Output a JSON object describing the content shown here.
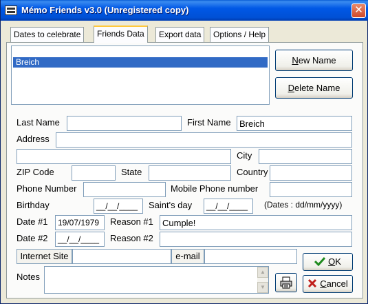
{
  "window": {
    "title": "Mémo Friends v3.0 (Unregistered copy)",
    "close": "✕"
  },
  "tabs": [
    {
      "label": "Dates to celebrate"
    },
    {
      "label": "Friends Data"
    },
    {
      "label": "Export data"
    },
    {
      "label": "Options / Help"
    }
  ],
  "friends_list": {
    "items": [
      "Breich"
    ],
    "selected": "Breich"
  },
  "buttons": {
    "new_name_u": "N",
    "new_name_rest": "ew Name",
    "delete_name_u": "D",
    "delete_name_rest": "elete Name",
    "ok_u": "O",
    "ok_rest": "K",
    "cancel_u": "C",
    "cancel_rest": "ancel",
    "internet_site": "Internet Site",
    "email": "e-mail"
  },
  "labels": {
    "last_name": "Last Name",
    "first_name": "First Name",
    "address": "Address",
    "city": "City",
    "zip": "ZIP Code",
    "state": "State",
    "country": "Country",
    "phone": "Phone Number",
    "mobile": "Mobile Phone number",
    "birthday": "Birthday",
    "saints_day": "Saint's day",
    "date_format": "(Dates : dd/mm/yyyy)",
    "date1": "Date #1",
    "reason1": "Reason #1",
    "date2": "Date #2",
    "reason2": "Reason #2",
    "notes": "Notes"
  },
  "values": {
    "last_name": "",
    "first_name": "Breich",
    "address1": "",
    "address2": "",
    "city": "",
    "zip": "",
    "state": "",
    "country": "",
    "phone": "",
    "mobile": "",
    "birthday": "__/__/____",
    "saints_day": "__/__/____",
    "date1": "19/07/1979",
    "reason1": "Cumple!",
    "date2": "__/__/____",
    "reason2": "",
    "internet_site": "",
    "email": "",
    "notes": ""
  },
  "colors": {
    "selection": "#316AC5",
    "ok_check": "#1E8A1E",
    "cancel_x": "#C0201C"
  },
  "icons": {
    "print": "printer-icon",
    "ok": "checkmark-icon",
    "cancel": "x-icon"
  }
}
